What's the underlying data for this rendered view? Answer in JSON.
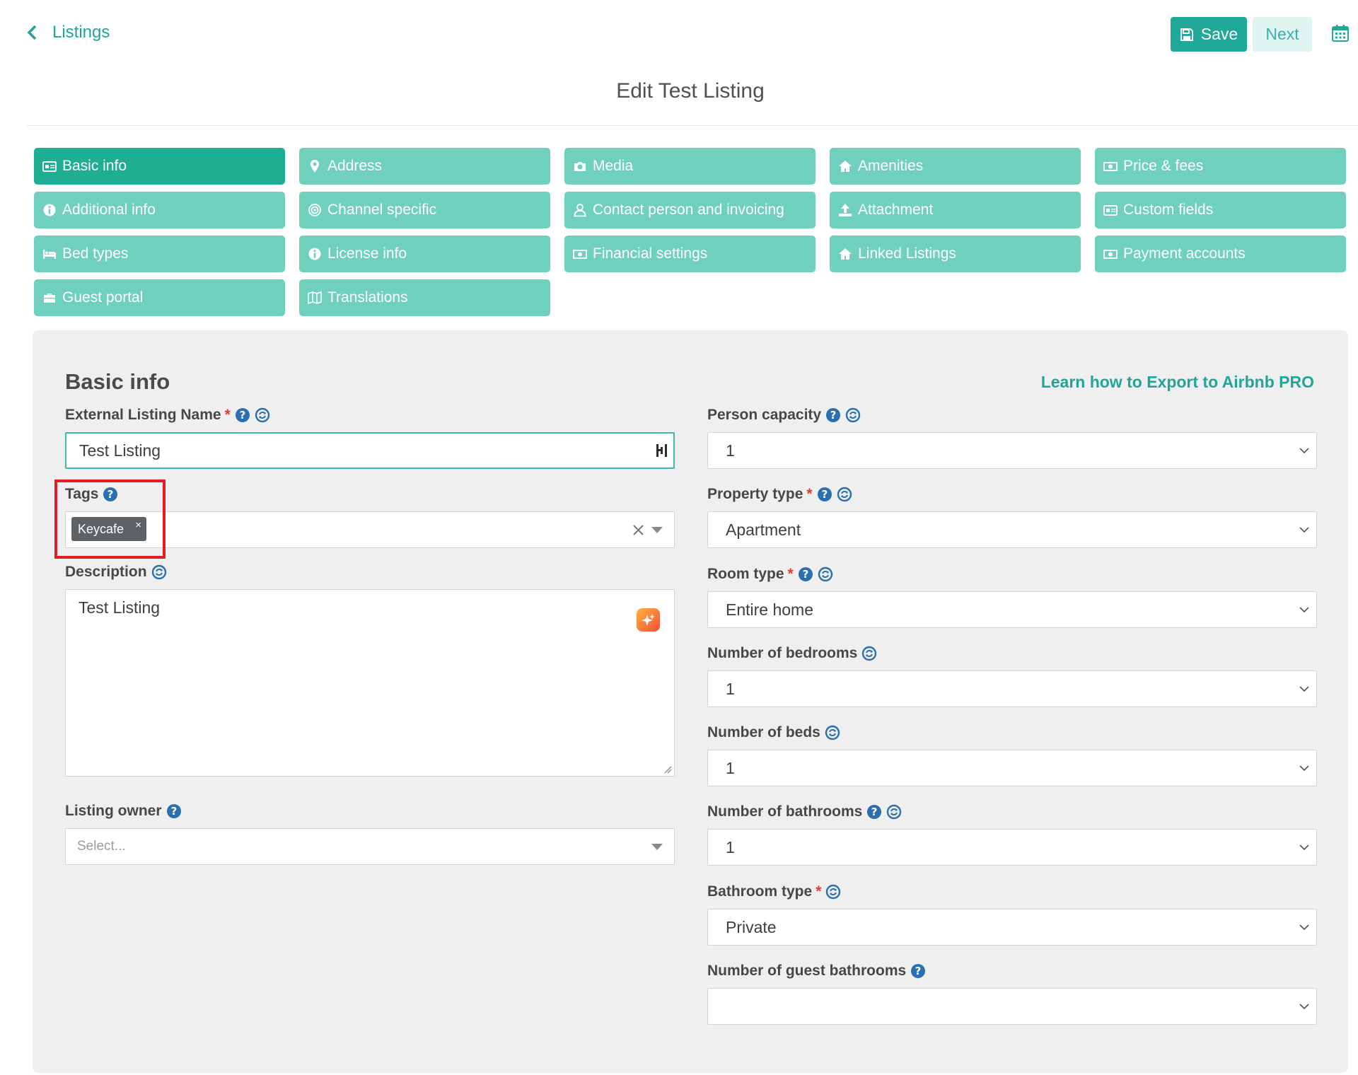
{
  "header": {
    "back_label": "Listings",
    "save_label": "Save",
    "next_label": "Next",
    "page_title": "Edit Test Listing"
  },
  "tabs": [
    {
      "label": "Basic info",
      "icon": "id-card-icon",
      "active": true
    },
    {
      "label": "Address",
      "icon": "map-marker-icon",
      "active": false
    },
    {
      "label": "Media",
      "icon": "camera-icon",
      "active": false
    },
    {
      "label": "Amenities",
      "icon": "home-icon",
      "active": false
    },
    {
      "label": "Price & fees",
      "icon": "money-icon",
      "active": false
    },
    {
      "label": "Additional info",
      "icon": "info-circle-icon",
      "active": false
    },
    {
      "label": "Channel specific",
      "icon": "target-icon",
      "active": false
    },
    {
      "label": "Contact person and invoicing",
      "icon": "user-icon",
      "active": false
    },
    {
      "label": "Attachment",
      "icon": "upload-icon",
      "active": false
    },
    {
      "label": "Custom fields",
      "icon": "id-card-icon",
      "active": false
    },
    {
      "label": "Bed types",
      "icon": "bed-icon",
      "active": false
    },
    {
      "label": "License info",
      "icon": "info-circle-icon",
      "active": false
    },
    {
      "label": "Financial settings",
      "icon": "money-icon",
      "active": false
    },
    {
      "label": "Linked Listings",
      "icon": "home-icon",
      "active": false
    },
    {
      "label": "Payment accounts",
      "icon": "money-icon",
      "active": false
    },
    {
      "label": "Guest portal",
      "icon": "briefcase-icon",
      "active": false
    },
    {
      "label": "Translations",
      "icon": "map-icon",
      "active": false
    }
  ],
  "section": {
    "title": "Basic info",
    "export_link": "Learn how to Export to Airbnb PRO"
  },
  "left": {
    "external_name_label": "External Listing Name",
    "external_name_value": "Test Listing",
    "tags_label": "Tags",
    "tag_value": "Keycafe",
    "tag_remove": "×",
    "description_label": "Description",
    "description_value": "Test Listing",
    "owner_label": "Listing owner",
    "owner_placeholder": "Select..."
  },
  "right": {
    "person_capacity_label": "Person capacity",
    "person_capacity_value": "1",
    "property_type_label": "Property type",
    "property_type_value": "Apartment",
    "room_type_label": "Room type",
    "room_type_value": "Entire home",
    "bedrooms_label": "Number of bedrooms",
    "bedrooms_value": "1",
    "beds_label": "Number of beds",
    "beds_value": "1",
    "bathrooms_label": "Number of bathrooms",
    "bathrooms_value": "1",
    "bathroom_type_label": "Bathroom type",
    "bathroom_type_value": "Private",
    "guest_bathrooms_label": "Number of guest bathrooms",
    "guest_bathrooms_value": ""
  },
  "colors": {
    "accent": "#20a898",
    "tab": "#6fd0bd",
    "tab_active": "#1eae94",
    "required": "#e23b2e",
    "highlight": "#e01d24",
    "help": "#2a6fb0"
  }
}
